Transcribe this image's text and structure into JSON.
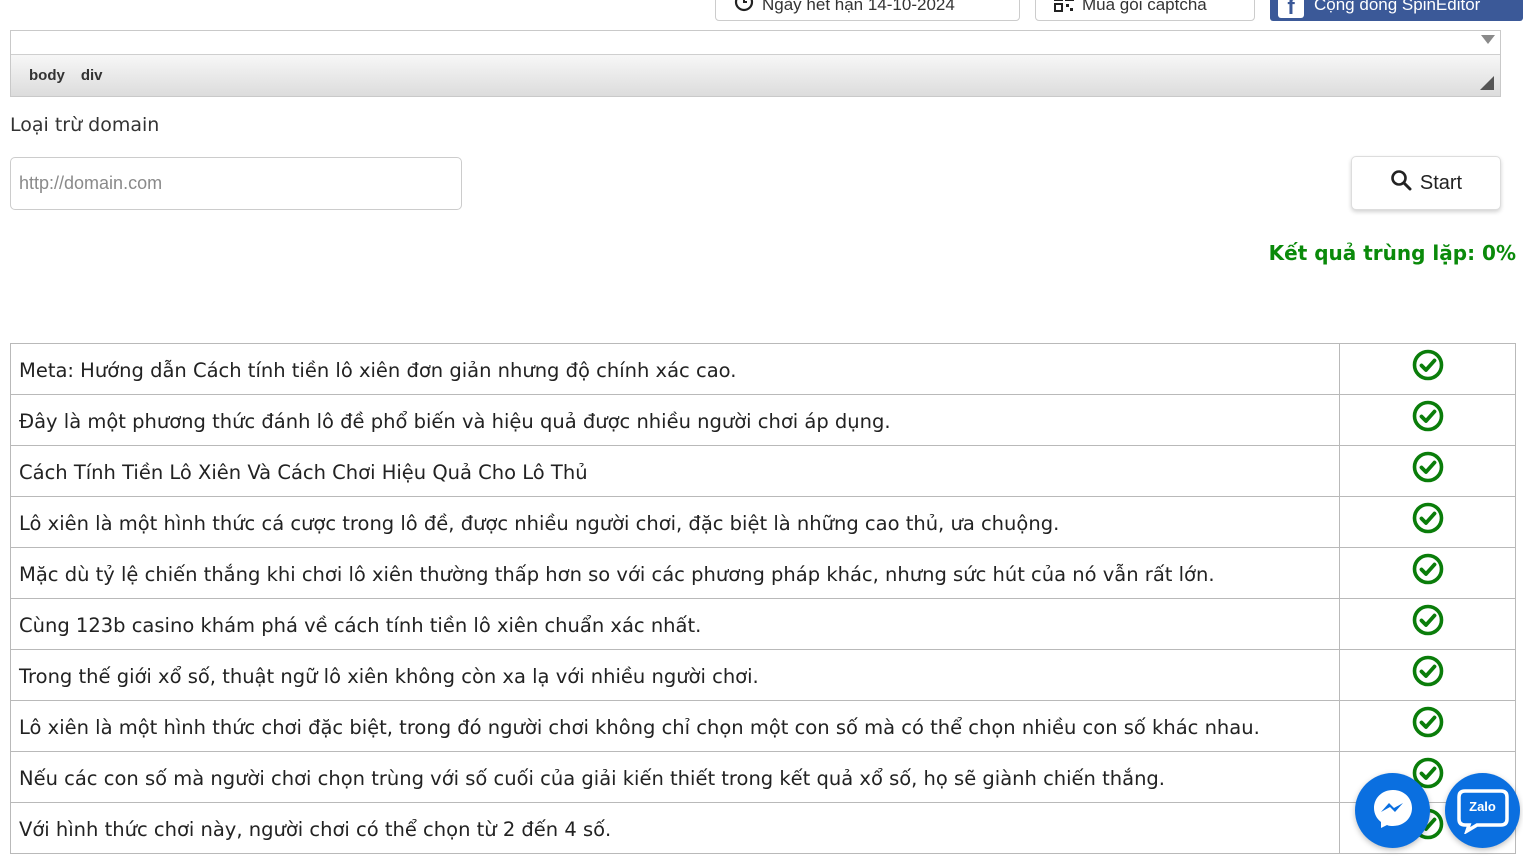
{
  "toolbar": {
    "expiry_label": "Ngày hết hạn 14-10-2024",
    "captcha_label": "Mua gói captcha",
    "community_label": "Cộng đồng SpinEditor"
  },
  "editor": {
    "path": [
      "body",
      "div"
    ]
  },
  "exclude": {
    "label": "Loại trừ domain",
    "placeholder": "http://domain.com",
    "value": ""
  },
  "start_label": "Start",
  "result": {
    "text": "Kết quả trùng lặp: 0%",
    "color": "#0a8a0a"
  },
  "rows": [
    {
      "text": "Meta: Hướng dẫn Cách tính tiền lô xiên đơn giản nhưng độ chính xác cao.",
      "status": "check"
    },
    {
      "text": "Đây là một phương thức đánh lô đề phổ biến và hiệu quả được nhiều người chơi áp dụng.",
      "status": "check"
    },
    {
      "text": "Cách Tính Tiền Lô Xiên Và Cách Chơi Hiệu Quả Cho Lô Thủ",
      "status": "check"
    },
    {
      "text": "Lô xiên là một hình thức cá cược trong lô đề, được nhiều người chơi, đặc biệt là những cao thủ, ưa chuộng.",
      "status": "check"
    },
    {
      "text": "Mặc dù tỷ lệ chiến thắng khi chơi lô xiên thường thấp hơn so với các phương pháp khác, nhưng sức hút của nó vẫn rất lớn.",
      "status": "check"
    },
    {
      "text": "Cùng 123b casino khám phá về cách tính tiền lô xiên chuẩn xác nhất.",
      "status": "check"
    },
    {
      "text": "Trong thế giới xổ số, thuật ngữ lô xiên không còn xa lạ với nhiều người chơi.",
      "status": "check"
    },
    {
      "text": "Lô xiên là một hình thức chơi đặc biệt, trong đó người chơi không chỉ chọn một con số mà có thể chọn nhiều con số khác nhau.",
      "status": "check"
    },
    {
      "text": "Nếu các con số mà người chơi chọn trùng với số cuối của giải kiến thiết trong kết quả xổ số, họ sẽ giành chiến thắng.",
      "status": "check"
    },
    {
      "text": "Với hình thức chơi này, người chơi có thể chọn từ 2 đến 4 số.",
      "status": "check"
    }
  ],
  "colors": {
    "check": "#0a7d0a",
    "fab": "#0a6fe0",
    "facebook": "#3b5998"
  },
  "fab": {
    "zalo_text": "Zalo"
  }
}
